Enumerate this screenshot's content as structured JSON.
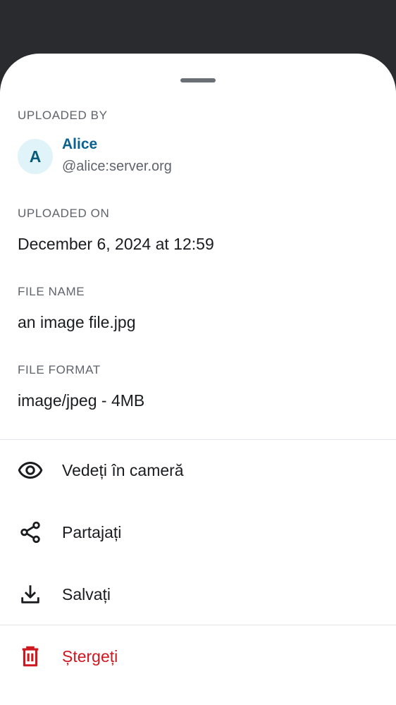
{
  "uploaded_by": {
    "label": "UPLOADED BY",
    "avatar_letter": "A",
    "name": "Alice",
    "user_id": "@alice:server.org"
  },
  "uploaded_on": {
    "label": "UPLOADED ON",
    "value": "December 6, 2024 at 12:59"
  },
  "file_name": {
    "label": "FILE NAME",
    "value": "an image file.jpg"
  },
  "file_format": {
    "label": "FILE FORMAT",
    "value": "image/jpeg - 4MB"
  },
  "actions": {
    "view": {
      "label": "Vedeți în cameră",
      "icon": "eye-icon"
    },
    "share": {
      "label": "Partajați",
      "icon": "share-icon"
    },
    "save": {
      "label": "Salvați",
      "icon": "download-icon"
    },
    "delete": {
      "label": "Ștergeți",
      "icon": "trash-icon"
    }
  },
  "colors": {
    "accent": "#0a6290",
    "avatar_bg": "#dff3f8",
    "danger": "#d0171f",
    "scrim": "#2a2b2e"
  }
}
